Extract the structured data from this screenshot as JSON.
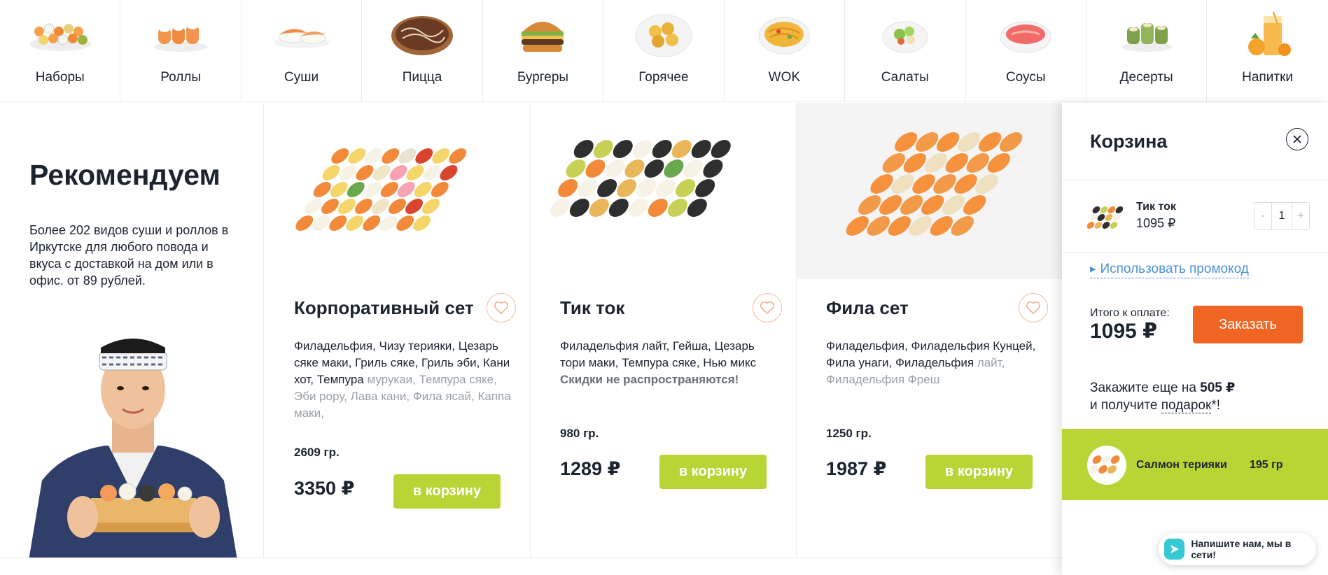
{
  "categories": [
    {
      "label": "Наборы",
      "icon": "sushi-set-icon"
    },
    {
      "label": "Роллы",
      "icon": "rolls-icon"
    },
    {
      "label": "Суши",
      "icon": "sushi-icon"
    },
    {
      "label": "Пицца",
      "icon": "pizza-icon"
    },
    {
      "label": "Бургеры",
      "icon": "burger-icon"
    },
    {
      "label": "Горячее",
      "icon": "hot-dish-icon"
    },
    {
      "label": "WOK",
      "icon": "wok-icon"
    },
    {
      "label": "Салаты",
      "icon": "salad-icon"
    },
    {
      "label": "Соусы",
      "icon": "sauce-icon"
    },
    {
      "label": "Десерты",
      "icon": "dessert-icon"
    },
    {
      "label": "Напитки",
      "icon": "drink-icon"
    }
  ],
  "promo": {
    "title": "Рекомендуем",
    "text": "Более 202 видов суши и роллов в Иркутске для любого повода и вкуса с доставкой на дом или в офис. от 89 рублей."
  },
  "products": [
    {
      "title": "Корпоративный сет",
      "desc_main": "Филадельфия, Чизу терияки, Цезарь сяке маки, Гриль сяке, Гриль эби, Кани хот, Темпура",
      "desc_faded": "мурукаи, Темпура сяке, Эби рору, Лава кани, Фила ясай, Каппа маки,",
      "warning": "",
      "weight": "2609  гр.",
      "price": "3350 ₽",
      "button": "в корзину"
    },
    {
      "title": "Тик ток",
      "desc_main": "Филадельфия лайт, Гейша, Цезарь тори маки, Темпура сяке, Нью микс",
      "desc_faded": "",
      "warning": "Скидки не распространяются!",
      "weight": "980  гр.",
      "price": "1289 ₽",
      "button": "в корзину"
    },
    {
      "title": "Фила сет",
      "desc_main": "Филадельфия, Филадельфия Кунцей, Фила унаги, Филадельфия",
      "desc_faded": "лайт, Филадельфия Фреш",
      "warning": "",
      "weight": "1250  гр.",
      "price": "1987 ₽",
      "button": "в корзину"
    }
  ],
  "cart": {
    "title": "Корзина",
    "item": {
      "name": "Тик ток",
      "price": "1095 ₽",
      "qty": "1",
      "minus": "-",
      "plus": "+"
    },
    "promo_link": "Использовать промокод",
    "total_label": "Итого к оплате:",
    "total_value": "1095 ₽",
    "order_button": "Заказать",
    "gift_line1_pre": "Закажите еще на ",
    "gift_amount": "505 ₽",
    "gift_line2_pre": "и получите ",
    "gift_link": "подарок",
    "gift_line2_post": "*!",
    "gift_item": {
      "name": "Салмон терияки",
      "weight": "195 гр"
    }
  },
  "chat": {
    "text": "Напишите нам, мы в сети!"
  },
  "colors": {
    "accent_green": "#b7d535",
    "accent_orange": "#f06524",
    "link_blue": "#4a90d9",
    "text_dark": "#1c2430"
  }
}
